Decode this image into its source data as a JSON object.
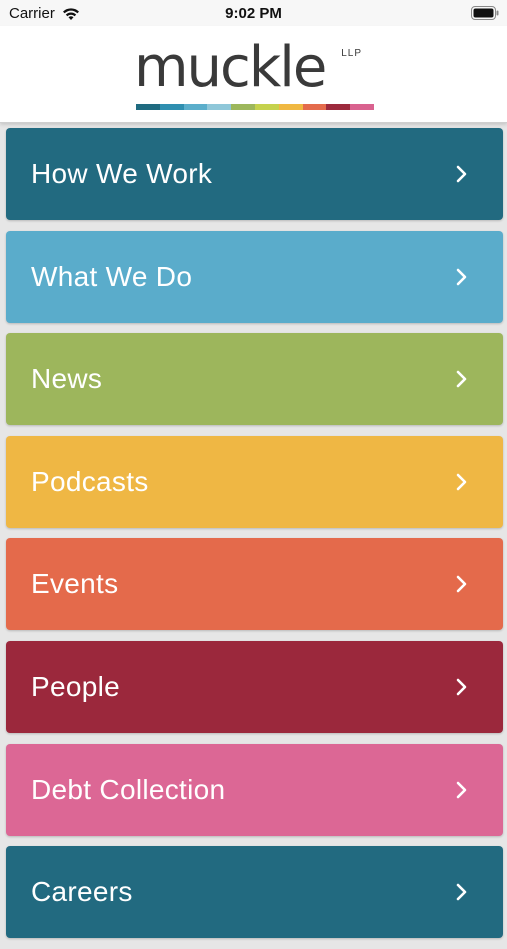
{
  "status_bar": {
    "carrier": "Carrier",
    "time": "9:02 PM"
  },
  "header": {
    "logo_text": "muckle",
    "logo_suffix": "LLP",
    "stripe_colors": [
      "#1f6b80",
      "#2f8fb0",
      "#5baecb",
      "#8fc7d9",
      "#9db75c",
      "#c5d24d",
      "#f0b842",
      "#e46b4c",
      "#9d2a3d",
      "#d9628f"
    ]
  },
  "menu": {
    "items": [
      {
        "label": "How We Work",
        "color": "#226a80",
        "icon": "chevron-right-icon"
      },
      {
        "label": "What We Do",
        "color": "#5aaccb",
        "icon": "chevron-right-icon"
      },
      {
        "label": "News",
        "color": "#9db65c",
        "icon": "chevron-right-icon"
      },
      {
        "label": "Podcasts",
        "color": "#efb744",
        "icon": "chevron-right-icon"
      },
      {
        "label": "Events",
        "color": "#e46a4b",
        "icon": "chevron-right-icon"
      },
      {
        "label": "People",
        "color": "#9b283c",
        "icon": "chevron-right-icon"
      },
      {
        "label": "Debt Collection",
        "color": "#dc6795",
        "icon": "chevron-right-icon"
      },
      {
        "label": "Careers",
        "color": "#226a80",
        "icon": "chevron-right-icon"
      }
    ]
  }
}
